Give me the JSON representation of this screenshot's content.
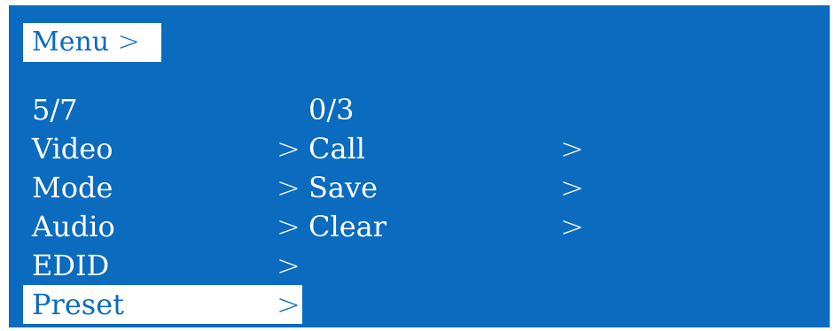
{
  "header": {
    "title": "Menu",
    "chevron": ">"
  },
  "left_menu": {
    "counter": "5/7",
    "items": [
      {
        "label": "Video",
        "arrow": ">"
      },
      {
        "label": "Mode",
        "arrow": ">"
      },
      {
        "label": "Audio",
        "arrow": ">"
      },
      {
        "label": "EDID",
        "arrow": ">"
      },
      {
        "label": "Preset",
        "arrow": ">"
      }
    ],
    "selected_index": 4
  },
  "right_menu": {
    "counter": "0/3",
    "items": [
      {
        "label": "Call",
        "arrow": ">"
      },
      {
        "label": "Save",
        "arrow": ">"
      },
      {
        "label": "Clear",
        "arrow": ">"
      }
    ]
  },
  "colors": {
    "background": "#0a6bbf",
    "text": "#ffffff",
    "highlight": "#ffffff"
  }
}
